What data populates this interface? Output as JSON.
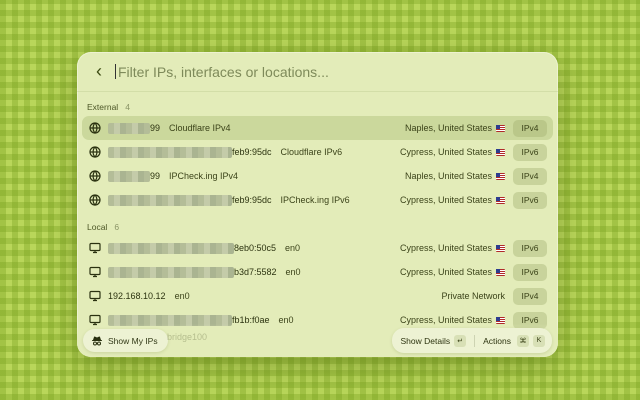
{
  "search": {
    "placeholder": "Filter IPs, interfaces or locations..."
  },
  "sections": {
    "external": {
      "label": "External",
      "count": "4"
    },
    "local": {
      "label": "Local",
      "count": "6"
    }
  },
  "external_rows": [
    {
      "ip_suffix": "99",
      "iface": "Cloudflare IPv4",
      "location": "Naples, United States",
      "badge": "IPv4",
      "icon": "globe-icon"
    },
    {
      "ip_suffix": "feb9:95dc",
      "iface": "Cloudflare IPv6",
      "location": "Cypress, United States",
      "badge": "IPv6",
      "icon": "globe-icon"
    },
    {
      "ip_suffix": "99",
      "iface": "IPCheck.ing IPv4",
      "location": "Naples, United States",
      "badge": "IPv4",
      "icon": "globe-icon"
    },
    {
      "ip_suffix": "feb9:95dc",
      "iface": "IPCheck.ing IPv6",
      "location": "Cypress, United States",
      "badge": "IPv6",
      "icon": "globe-icon"
    }
  ],
  "local_rows": [
    {
      "ip_suffix": "8eb0:50c5",
      "iface": "en0",
      "location": "Cypress, United States",
      "badge": "IPv6",
      "icon": "monitor-icon"
    },
    {
      "ip_suffix": "b3d7:5582",
      "iface": "en0",
      "location": "Cypress, United States",
      "badge": "IPv6",
      "icon": "monitor-icon"
    },
    {
      "ip_full": "192.168.10.12",
      "iface": "en0",
      "location": "Private Network",
      "badge": "IPv4",
      "icon": "monitor-icon"
    },
    {
      "ip_suffix": "fb1b:f0ae",
      "iface": "en0",
      "location": "Cypress, United States",
      "badge": "IPv6",
      "icon": "monitor-icon"
    }
  ],
  "footer": {
    "show_my_ips": "Show My IPs",
    "ghost_text": "bridge100",
    "show_details": "Show Details",
    "show_details_key": "↵",
    "actions": "Actions",
    "actions_key1": "⌘",
    "actions_key2": "K"
  }
}
